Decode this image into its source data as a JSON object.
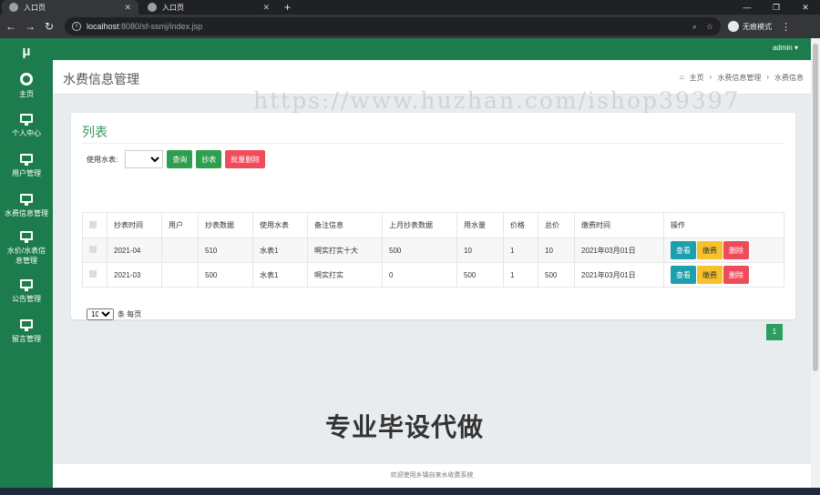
{
  "browser": {
    "tabs": [
      {
        "title": "入口页",
        "active": true
      },
      {
        "title": "入口页",
        "active": false
      }
    ],
    "address": {
      "host": "localhost",
      "path": ":8080/sf-ssmj/index.jsp"
    },
    "incognito_label": "无痕模式"
  },
  "sidebar": {
    "logo": "μ",
    "items": [
      {
        "label": "主页",
        "icon": "gauge-icon"
      },
      {
        "label": "个人中心",
        "icon": "monitor-icon"
      },
      {
        "label": "用户管理",
        "icon": "monitor-icon"
      },
      {
        "label": "水费信息管理",
        "icon": "monitor-icon"
      },
      {
        "label": "水价/水表信息管理",
        "icon": "monitor-icon"
      },
      {
        "label": "公告管理",
        "icon": "monitor-icon"
      },
      {
        "label": "留言管理",
        "icon": "monitor-icon"
      }
    ]
  },
  "topbar": {
    "user": "admin ▾"
  },
  "header": {
    "title": "水费信息管理",
    "breadcrumb": [
      "主页",
      "水费信息管理",
      "水费信息"
    ]
  },
  "watermark": "https://www.huzhan.com/ishop39397",
  "panel": {
    "title": "列表",
    "filter_label": "使用水表:",
    "buttons": {
      "query": "查询",
      "read_meter": "抄表",
      "batch_delete": "批量删除"
    },
    "columns": [
      "",
      "抄表时间",
      "用户",
      "抄表数据",
      "使用水表",
      "备注信息",
      "上月抄表数据",
      "用水量",
      "价格",
      "总价",
      "缴费时间",
      "操作"
    ],
    "rows": [
      {
        "time": "2021-04",
        "user": "",
        "reading": "510",
        "meter": "水表1",
        "note": "啊实打实十大",
        "last": "500",
        "usage": "10",
        "price": "1",
        "total": "10",
        "paytime": "2021年03月01日"
      },
      {
        "time": "2021-03",
        "user": "",
        "reading": "500",
        "meter": "水表1",
        "note": "啊实打实",
        "last": "0",
        "usage": "500",
        "price": "1",
        "total": "500",
        "paytime": "2021年03月01日"
      }
    ],
    "row_actions": {
      "view": "查看",
      "pay": "缴费",
      "delete": "删除"
    },
    "page_size": "10",
    "page_size_suffix": "条 每页",
    "current_page": "1"
  },
  "overlay_text": "专业毕设代做",
  "footer": "欢迎使用乡镇自来水收费系统",
  "colors": {
    "primary": "#1d7c4d",
    "accent": "#2e9e5f",
    "danger": "#ef4c5b",
    "info": "#1d9fae",
    "warning": "#f6c12a"
  }
}
